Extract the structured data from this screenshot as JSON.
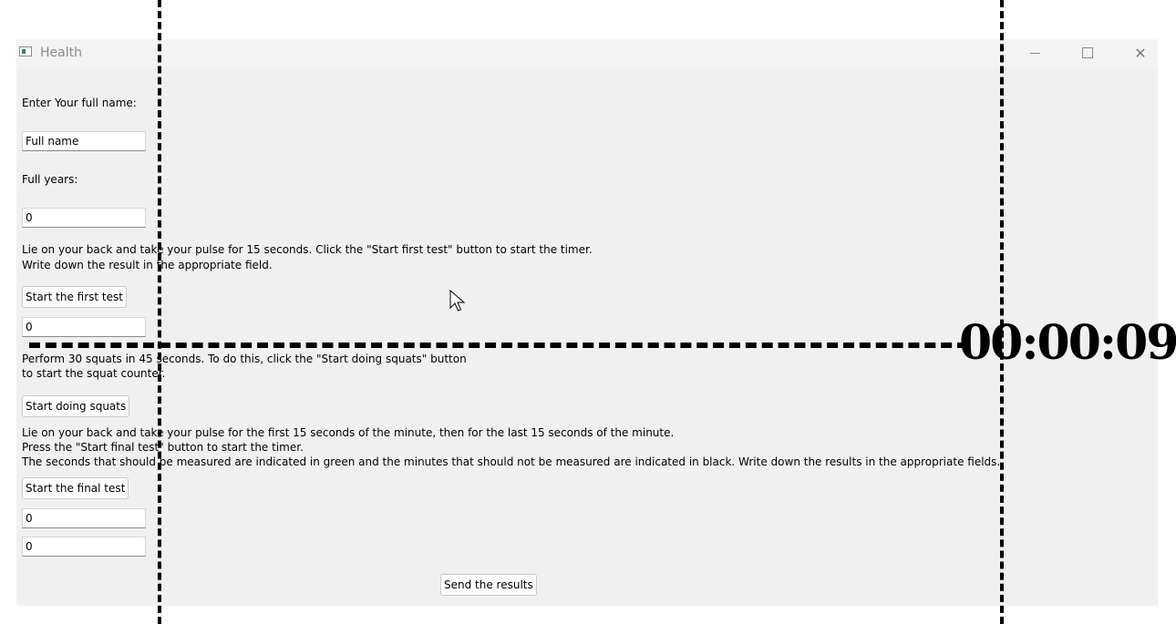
{
  "window": {
    "title": "Health",
    "icon": "app-icon",
    "controls": [
      "minimize-icon",
      "maximize-icon",
      "close-icon"
    ]
  },
  "form": {
    "name_label": "Enter Your full name:",
    "name_placeholder": "Full name",
    "name_value": "Full name",
    "years_label": "Full years:",
    "years_value": "0",
    "test1_instruction_line1": "Lie on your back and take your pulse for 15 seconds. Click the \"Start first test\" button to start the timer.",
    "test1_instruction_line2": "Write down the result in the appropriate field.",
    "start_first_test_label": "Start the first test",
    "test1_value": "0",
    "squats_instruction_line1": "Perform 30 squats in 45 seconds. To do this, click the \"Start doing squats\" button",
    "squats_instruction_line2": "to start the squat counter.",
    "start_squats_label": "Start doing squats",
    "final_instruction_line1": "Lie on your back and take your pulse for the first 15 seconds of the minute, then for the last 15 seconds of the minute.",
    "final_instruction_line2": "Press the \"Start final test\" button to start the timer.",
    "final_instruction_line3": "The seconds that should be measured are indicated in green and the minutes that should not be measured are indicated in black. Write down the results in the appropriate fields.",
    "start_final_test_label": "Start the final test",
    "final_value_1": "0",
    "final_value_2": "0",
    "send_results_label": "Send the results"
  },
  "timer": {
    "text": "00:00:09",
    "color": "#000000"
  }
}
